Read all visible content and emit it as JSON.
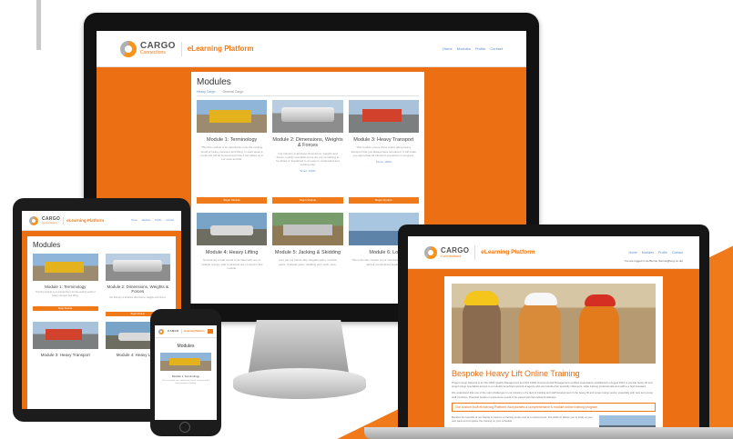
{
  "brand": {
    "logo_line1": "CARGO",
    "logo_line2": "Connections",
    "title": "eLearning Platform",
    "accent_color": "#f07a1a",
    "link_color": "#5b8fc9"
  },
  "nav": [
    "Home",
    "Modules",
    "Profile",
    "Contact"
  ],
  "logged_in_text": "You are logged in as Bernie (bernie@leng.co.uk)",
  "modules_page": {
    "heading": "Modules",
    "tabs": [
      "Heavy Cargo",
      "General Cargo"
    ],
    "start_label": "Begin Module",
    "modules": [
      {
        "title": "Module 1: Terminology",
        "desc": "This first module is an introduction into the exciting world of heavy transport and lifting. In each week a small unit will be covered and how it can affect us in our work and life.",
        "score": "",
        "icon": "truck-photo"
      },
      {
        "title": "Module 2: Dimensions, Weights & Forces",
        "desc": "Our industry is all about dimensions, weights and forces. Luckily specialist terms are not something to be afraid of. Explained in an easy to understand and exciting way.",
        "score": "Score: 100%",
        "icon": "tank-photo"
      },
      {
        "title": "Module 3: Heavy Transport",
        "desc": "This module covers those topics about heavy transport that you always have wondered. It will make you appreciate all transport operations in progress.",
        "score": "Score: 100%",
        "icon": "red-truck-photo"
      },
      {
        "title": "Module 4: Heavy Lifting",
        "desc": "Sometimes a load needs to be lifted with one or multiple cranes. Lifts of all kinds are covered in this module.",
        "score": "",
        "icon": "crane-photo"
      },
      {
        "title": "Module 5: Jacking & Skidding",
        "desc": "Let's get our hands dirty. Regular jacks, modular jacks, hydraulic jacks, skidding and much more.",
        "score": "",
        "icon": "jacking-photo"
      },
      {
        "title": "Module 6: Lo",
        "desc": "This is the last module of our introduction course and will tell you all about loading.",
        "score": "",
        "icon": "sea-photo"
      }
    ]
  },
  "tablet": {
    "heading": "Modules",
    "modules": [
      {
        "title": "Module 1: Terminology",
        "desc": "This first module is an introduction into the exciting world of heavy transport and lifting.",
        "score": ""
      },
      {
        "title": "Module 2: Dimensions, Weights & Forces",
        "desc": "Our industry is all about dimensions, weights and forces.",
        "score": "Score: 100%"
      },
      {
        "title": "Module 3: Heavy Transport",
        "desc": "",
        "score": ""
      },
      {
        "title": "Module 4: Heavy Lifting",
        "desc": "",
        "score": ""
      }
    ],
    "start_label": "Begin Module"
  },
  "phone": {
    "heading": "Modules",
    "module_title": "Module 1: Terminology",
    "module_desc": "This first module is an introduction into the exciting world of heavy transport and lifting."
  },
  "landing": {
    "heading": "Bespoke Heavy Lift Online Training",
    "intro": "Project Cargo Network is an ISO 9001 Quality Management and ISO 14001 Environmental Management certified organisation established in August 2010 to provide heavy lift and project cargo specialists access to a mutually beneficial network of agents who can handle their specialty shipments, while training professionals and staff to a high standard.",
    "para2": "We understand that one of the main challenges in our industry is the lack of training and staff development in the heavy lift and project cargo sector, especially with new and young staff members. Practical hands-on experience needs to be paired with theoretical knowledge.",
    "callout": "Our custom built eLearning Platform incorporates a comprehensive 6 module online training program.",
    "para3": "Besides the benefits of not having to travel to a training centre and at a reduced cost, this platform allows you to study at your own pace and complete the training on your schedule."
  }
}
